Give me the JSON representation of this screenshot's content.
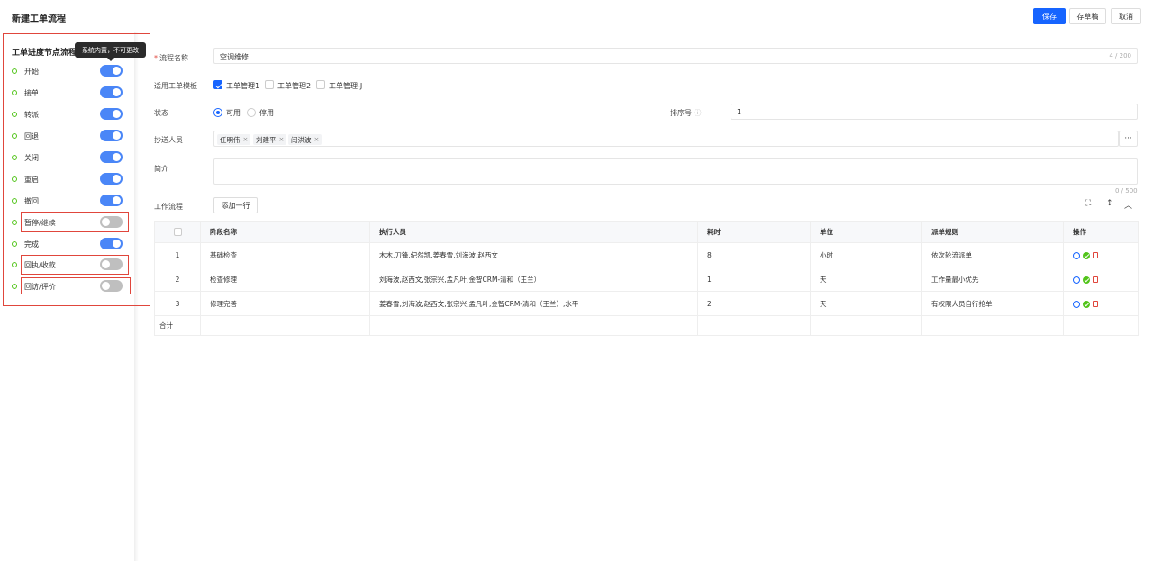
{
  "header": {
    "title": "新建工单流程",
    "buttons": {
      "save": "保存",
      "draft": "存草稿",
      "cancel": "取消"
    }
  },
  "left_panel": {
    "title": "工单进度节点流程",
    "tooltip": "系统内置，不可更改",
    "nodes": [
      {
        "label": "开始",
        "enabled": true
      },
      {
        "label": "接单",
        "enabled": true
      },
      {
        "label": "转派",
        "enabled": true
      },
      {
        "label": "回退",
        "enabled": true
      },
      {
        "label": "关闭",
        "enabled": true
      },
      {
        "label": "重启",
        "enabled": true
      },
      {
        "label": "撤回",
        "enabled": true
      },
      {
        "label": "暂停/继续",
        "enabled": false
      },
      {
        "label": "完成",
        "enabled": true
      },
      {
        "label": "回执/收款",
        "enabled": false
      },
      {
        "label": "回访/评价",
        "enabled": false
      }
    ]
  },
  "form": {
    "name_label": "流程名称",
    "name_value": "空调维修",
    "name_count": "4 / 200",
    "template_label": "适用工单模板",
    "templates": [
      {
        "label": "工单管理1",
        "checked": true
      },
      {
        "label": "工单管理2",
        "checked": false
      },
      {
        "label": "工单管理-J",
        "checked": false
      }
    ],
    "status_label": "状态",
    "status_options": [
      {
        "label": "可用",
        "selected": true
      },
      {
        "label": "停用",
        "selected": false
      }
    ],
    "sort_label": "排序号",
    "sort_value": "1",
    "cc_label": "抄送人员",
    "cc_people": [
      "任明伟",
      "刘建平",
      "闫洪波"
    ],
    "cc_more": "···",
    "intro_label": "简介",
    "intro_count": "0 / 500"
  },
  "workflow": {
    "label": "工作流程",
    "add_row": "添加一行",
    "columns": [
      "阶段名称",
      "执行人员",
      "耗时",
      "单位",
      "派单规则",
      "操作"
    ],
    "rows": [
      {
        "no": "1",
        "stage": "基础检查",
        "people": "木木,刀锋,纪然凯,姜春雪,刘海波,赵西文",
        "time": "8",
        "unit": "小时",
        "rule": "依次轮流派单"
      },
      {
        "no": "2",
        "stage": "检查修理",
        "people": "刘海波,赵西文,张宗兴,孟凡叶,金智CRM-清和（王兰）",
        "time": "1",
        "unit": "天",
        "rule": "工作量最小优先"
      },
      {
        "no": "3",
        "stage": "修理完善",
        "people": "姜春雪,刘海波,赵西文,张宗兴,孟凡叶,金智CRM-清和（王兰）,水平",
        "time": "2",
        "unit": "天",
        "rule": "有权限人员自行抢单"
      }
    ],
    "total_label": "合计"
  }
}
